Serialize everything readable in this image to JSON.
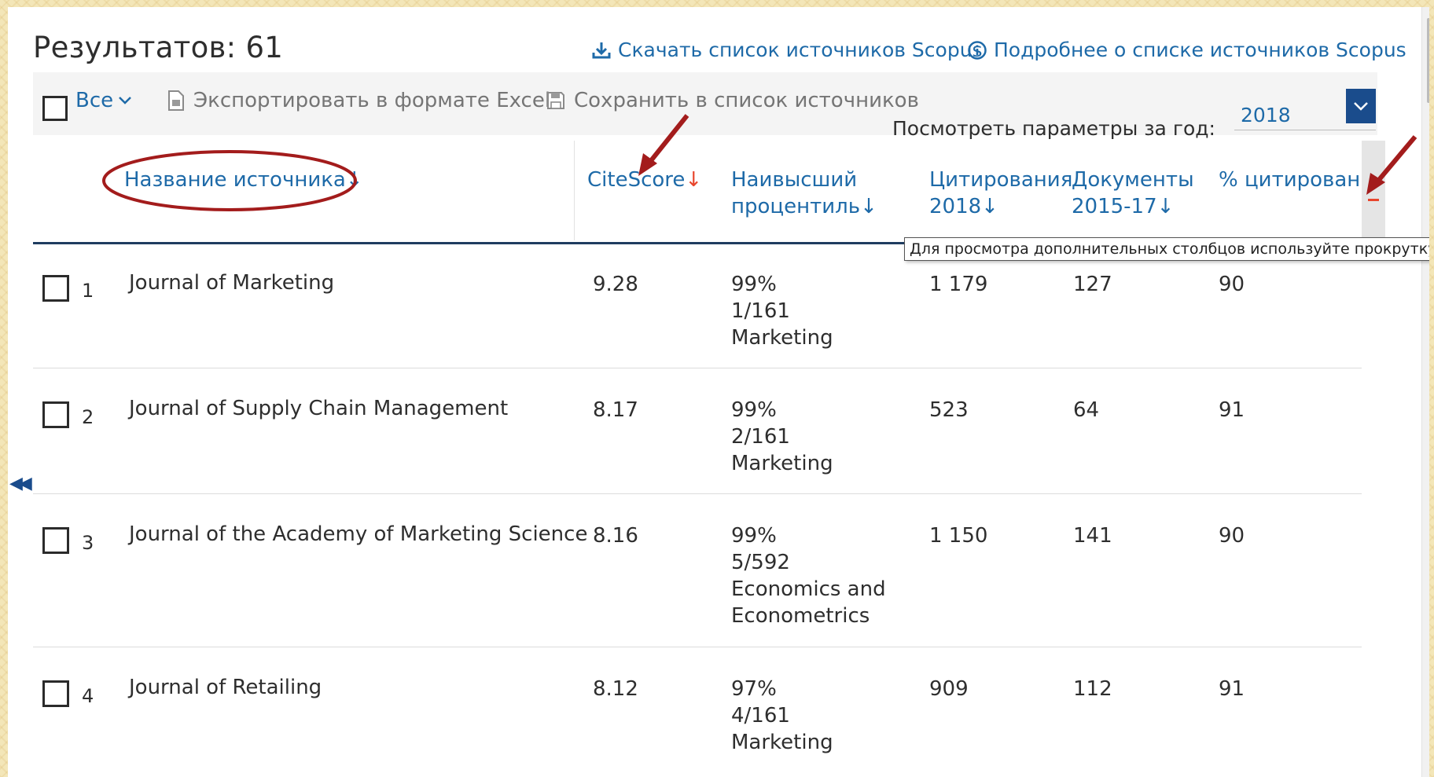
{
  "header": {
    "results_label": "Результатов: 61",
    "download_link": "Скачать список источников Scopus",
    "info_link": "Подробнее о списке источников Scopus"
  },
  "toolbar": {
    "select_all_label": "Все",
    "export_label": "Экспортировать в формате Excel",
    "save_label": "Сохранить в список источников",
    "year_label": "Посмотреть параметры за год:",
    "year_value": "2018"
  },
  "table": {
    "columns": {
      "source": "Название источника",
      "citescore": "CiteScore",
      "percentile_line1": "Наивысший",
      "percentile_line2": "процентиль",
      "citations_line1": "Цитирования",
      "citations_line2": "2018",
      "documents_line1": "Документы",
      "documents_line2": "2015-17",
      "percent_cited": "% цитирования"
    },
    "sort_arrow": "↓",
    "rows": [
      {
        "num": "1",
        "name": "Journal of Marketing",
        "citescore": "9.28",
        "pct": "99%",
        "rank": "1/161",
        "category": "Marketing",
        "citations": "1 179",
        "documents": "127",
        "percent_cited": "90"
      },
      {
        "num": "2",
        "name": "Journal of Supply Chain Management",
        "citescore": "8.17",
        "pct": "99%",
        "rank": "2/161",
        "category": "Marketing",
        "citations": "523",
        "documents": "64",
        "percent_cited": "91"
      },
      {
        "num": "3",
        "name": "Journal of the Academy of Marketing Science",
        "citescore": "8.16",
        "pct": "99%",
        "rank": "5/592",
        "category": "Economics and Econometrics",
        "citations": "1 150",
        "documents": "141",
        "percent_cited": "90"
      },
      {
        "num": "4",
        "name": "Journal of Retailing",
        "citescore": "8.12",
        "pct": "97%",
        "rank": "4/161",
        "category": "Marketing",
        "citations": "909",
        "documents": "112",
        "percent_cited": "91"
      }
    ]
  },
  "tooltip": "Для просмотра дополнительных столбцов используйте прокрутку",
  "colors": {
    "link": "#1e6aa8",
    "active_sort": "#e8452c",
    "annotation": "#a31c1c",
    "year_button": "#1a4c8c"
  }
}
